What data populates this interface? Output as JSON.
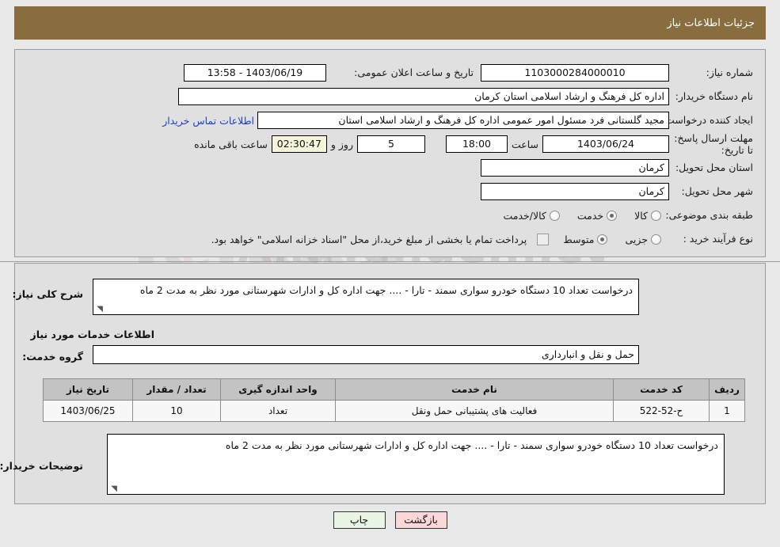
{
  "header": {
    "title": "جزئیات اطلاعات نیاز",
    "bar_color": "#8a6d3f"
  },
  "top_panel": {
    "need_number": {
      "label": "شماره نیاز:",
      "value": "1103000284000010"
    },
    "announce_datetime": {
      "label": "تاریخ و ساعت اعلان عمومی:",
      "value": "1403/06/19 - 13:58"
    },
    "buyer_org": {
      "label": "نام دستگاه خریدار:",
      "value": "اداره کل فرهنگ و ارشاد اسلامی استان کرمان"
    },
    "request_creator": {
      "label": "ایجاد کننده درخواست:",
      "value": "مجید گلستانی فرد مسئول امور عمومی اداره کل فرهنگ و ارشاد اسلامی استان",
      "contact_link": "اطلاعات تماس خریدار"
    },
    "deadline": {
      "label": "مهلت ارسال پاسخ: تا تاریخ:",
      "date": "1403/06/24",
      "hour_label": "ساعت",
      "hour": "18:00",
      "days": "5",
      "days_label": "روز و",
      "timer": "02:30:47",
      "timer_label": "ساعت باقی مانده"
    },
    "delivery_province": {
      "label": "استان محل تحویل:",
      "value": "کرمان"
    },
    "delivery_city": {
      "label": "شهر محل تحویل:",
      "value": "کرمان"
    },
    "subject_category": {
      "label": "طبقه بندی موضوعی:",
      "options": [
        "کالا",
        "خدمت",
        "کالا/خدمت"
      ],
      "selected": "خدمت"
    },
    "purchase_type": {
      "label": "نوع فرآیند خرید :",
      "options": [
        "جزیی",
        "متوسط"
      ],
      "selected": "متوسط",
      "checkbox_note": "پرداخت تمام یا بخشی از مبلغ خرید،از محل \"اسناد خزانه اسلامی\" خواهد بود.",
      "checkbox_checked": false
    }
  },
  "mid_panel": {
    "general_description": {
      "label": "شرح کلی نیاز:",
      "value": "درخواست تعداد 10 دستگاه خودرو سواری سمند - تارا - .... جهت اداره کل و ادارات شهرستانی مورد نظر به مدت 2 ماه"
    },
    "services_section_title": "اطلاعات خدمات مورد نیاز",
    "service_group": {
      "label": "گروه خدمت:",
      "value": "حمل و نقل و انبارداری"
    },
    "table": {
      "columns": [
        "ردیف",
        "کد خدمت",
        "نام خدمت",
        "واحد اندازه گیری",
        "تعداد / مقدار",
        "تاریخ نیاز"
      ],
      "rows": [
        {
          "radif": "1",
          "service_code": "ح-52-522",
          "service_name": "فعالیت های پشتیبانی حمل ونقل",
          "unit": "تعداد",
          "quantity": "10",
          "need_date": "1403/06/25"
        }
      ]
    },
    "buyer_notes": {
      "label": "توضیحات خریدار:",
      "value": "درخواست تعداد 10 دستگاه خودرو سواری سمند - تارا - .... جهت اداره کل و ادارات شهرستانی مورد نظر به مدت 2 ماه"
    }
  },
  "footer": {
    "print_button": "چاپ",
    "back_button": "بازگشت"
  },
  "watermark": {
    "brand": "AnaTender.net",
    "shield_icon": "shield-icon"
  }
}
